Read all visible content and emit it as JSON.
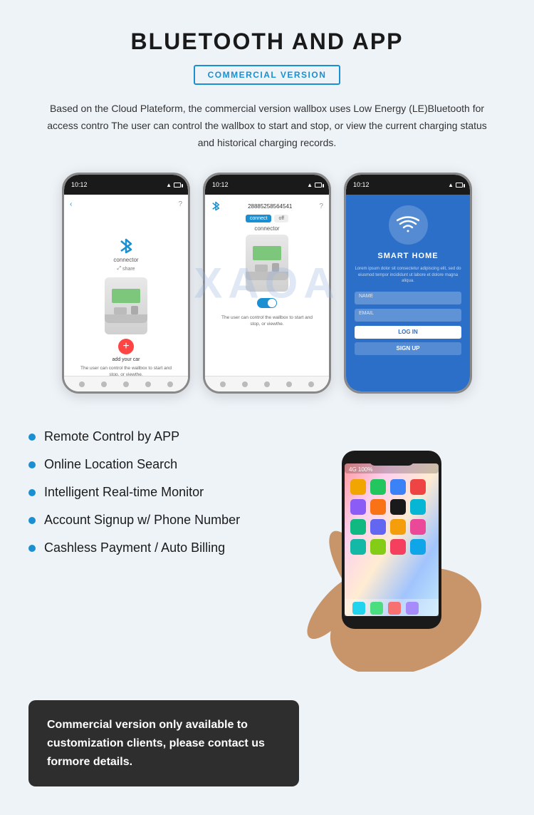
{
  "header": {
    "title": "BLUETOOTH AND APP",
    "badge": "COMMERCIAL VERSION",
    "description": "Based on the Cloud Plateform, the commercial version wallbox uses Low Energy (LE)Bluetooth for access contro The user can control the wallbox to start and stop, or view the current charging status and historical charging records."
  },
  "phones": [
    {
      "time": "10:12",
      "type": "connector",
      "label": "connector",
      "share": "share",
      "add_car": "add your car",
      "desc": "The user can control the wallbox to start and stop, or viewthe."
    },
    {
      "time": "10:12",
      "type": "control",
      "id_number": "28885258564541",
      "connect_label": "connect",
      "off_label": "off",
      "label": "connector",
      "desc": "The user can control the wallbox to start and stop, or viewthe."
    },
    {
      "time": "10:12",
      "type": "smart-home",
      "title": "SMART HOME",
      "desc_text": "Lorem ipsum dolor sit consectetur adipiscing elit, sed do eiusmod tempor incididunt ut labore et dolore magna aliqua.",
      "name_placeholder": "NAME",
      "email_placeholder": "EMAIL",
      "login_label": "LOG IN",
      "signup_label": "SIGN UP"
    }
  ],
  "features": [
    {
      "text": "Remote Control by APP"
    },
    {
      "text": "Online Location Search"
    },
    {
      "text": "Intelligent Real-time Monitor"
    },
    {
      "text": "Account Signup w/ Phone Number"
    },
    {
      "text": "Cashless Payment / Auto Billing"
    }
  ],
  "notice": {
    "text": "Commercial version only available to customization clients, please contact us formore details."
  },
  "colors": {
    "accent": "#1a8fd1",
    "dark": "#2e2e2e",
    "bullet": "#1a8fd1"
  }
}
